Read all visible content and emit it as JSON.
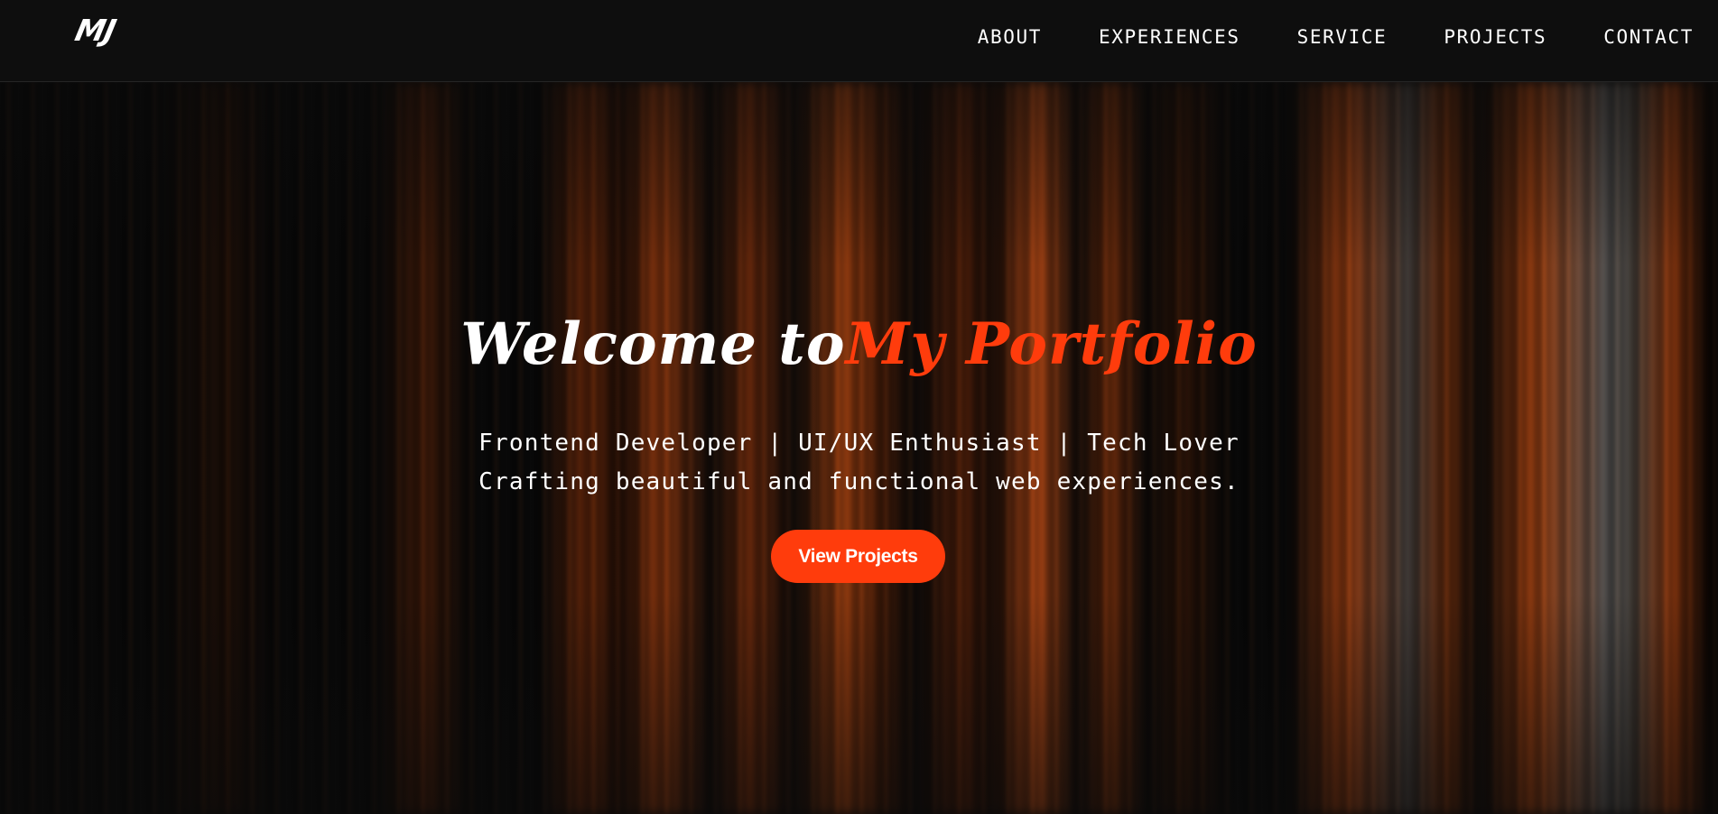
{
  "header": {
    "logo": "MJ",
    "nav": [
      {
        "label": "ABOUT"
      },
      {
        "label": "EXPERIENCES"
      },
      {
        "label": "SERVICE"
      },
      {
        "label": "PROJECTS"
      },
      {
        "label": "CONTACT"
      }
    ]
  },
  "hero": {
    "title_part1": "Welcome to",
    "title_part2": "My Portfolio",
    "subtitle_line1": "Frontend Developer | UI/UX Enthusiast | Tech Lover",
    "subtitle_line2": "Crafting beautiful and functional web experiences.",
    "cta_label": "View Projects"
  },
  "colors": {
    "accent": "#ff3c0c",
    "background": "#0b0b0b",
    "text": "#ffffff"
  }
}
